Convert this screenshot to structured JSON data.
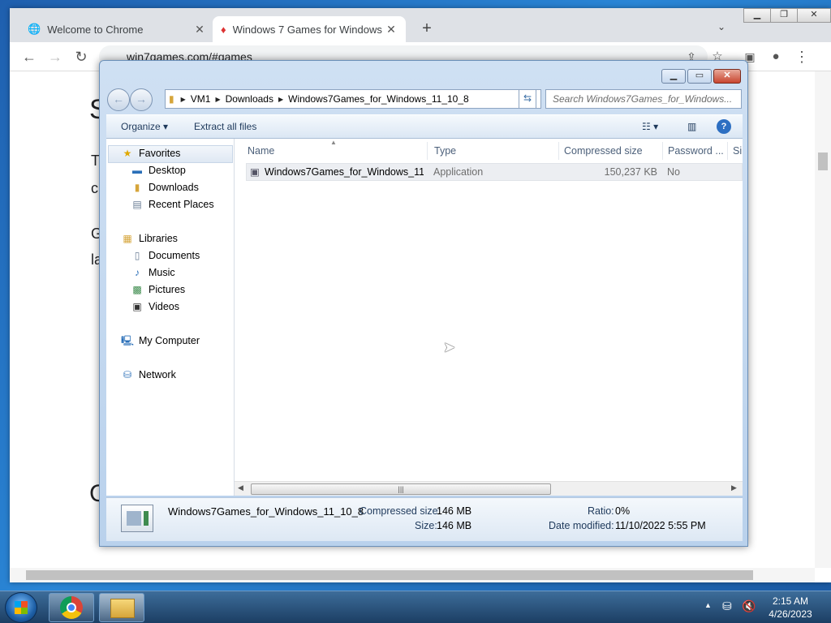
{
  "browser": {
    "tabs": [
      {
        "title": "Welcome to Chrome"
      },
      {
        "title": "Windows 7 Games for Windows"
      }
    ],
    "url": "win7games.com/#games",
    "page_fragments": [
      "S",
      "T",
      "c",
      "G",
      "la",
      "C"
    ]
  },
  "explorer": {
    "breadcrumb": [
      "VM1",
      "Downloads",
      "Windows7Games_for_Windows_11_10_8"
    ],
    "search_placeholder": "Search Windows7Games_for_Windows...",
    "commands": {
      "organize": "Organize",
      "extract": "Extract all files"
    },
    "nav": {
      "favorites": "Favorites",
      "desktop": "Desktop",
      "downloads": "Downloads",
      "recent": "Recent Places",
      "libraries": "Libraries",
      "documents": "Documents",
      "music": "Music",
      "pictures": "Pictures",
      "videos": "Videos",
      "computer": "My Computer",
      "network": "Network"
    },
    "columns": {
      "name": "Name",
      "type": "Type",
      "compressed": "Compressed size",
      "password": "Password ...",
      "size": "Si"
    },
    "file": {
      "name": "Windows7Games_for_Windows_11...",
      "type": "Application",
      "compressed": "150,237 KB",
      "password": "No"
    },
    "details": {
      "name": "Windows7Games_for_Windows_11_10_8",
      "compressed_label": "Compressed size:",
      "compressed_value": "146 MB",
      "size_label": "Size:",
      "size_value": "146 MB",
      "ratio_label": "Ratio:",
      "ratio_value": "0%",
      "modified_label": "Date modified:",
      "modified_value": "11/10/2022 5:55 PM"
    }
  },
  "taskbar": {
    "time": "2:15 AM",
    "date": "4/26/2023"
  }
}
